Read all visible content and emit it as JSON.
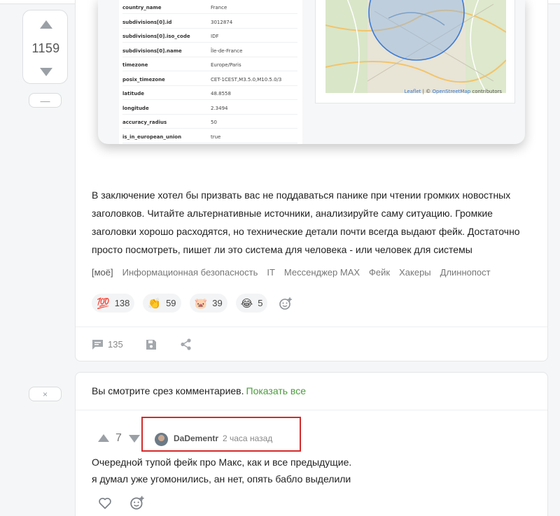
{
  "post": {
    "rating": "1159",
    "collapse_label": "—",
    "screenshot": {
      "rows": [
        {
          "key": "country_name",
          "value": "France"
        },
        {
          "key": "subdivisions[0].id",
          "value": "3012874"
        },
        {
          "key": "subdivisions[0].iso_code",
          "value": "IDF"
        },
        {
          "key": "subdivisions[0].name",
          "value": "Île-de-France"
        },
        {
          "key": "timezone",
          "value": "Europe/Paris"
        },
        {
          "key": "posix_timezone",
          "value": "CET-1CEST,M3.5.0,M10.5.0/3"
        },
        {
          "key": "latitude",
          "value": "48.8558"
        },
        {
          "key": "longitude",
          "value": "2.3494"
        },
        {
          "key": "accuracy_radius",
          "value": "50"
        },
        {
          "key": "is_in_european_union",
          "value": "true"
        }
      ],
      "map_attribution": {
        "leaflet": "Leaflet",
        "sep": " | © ",
        "osm": "OpenStreetMap",
        "suffix": " contributors"
      }
    },
    "text_lines": [
      "В заключение хотел бы призвать вас не поддаваться панике при чтении громких новостных",
      "заголовков. Читайте альтернативные источники, анализируйте саму ситуацию. Громкие",
      "заголовки хорошо расходятся, но технические детали почти всегда выдают фейк. Достаточно",
      "просто посмотреть, пишет ли это система для человека - или человек для системы"
    ],
    "tags": [
      "[моё]",
      "Информационная безопасность",
      "IT",
      "Мессенджер MAX",
      "Фейк",
      "Хакеры",
      "Длиннопост"
    ],
    "reactions": [
      {
        "emoji": "💯",
        "count": "138"
      },
      {
        "emoji": "👏",
        "count": "59"
      },
      {
        "emoji": "🐷",
        "count": "39"
      },
      {
        "emoji": "😂",
        "count": "5"
      }
    ],
    "comments_count": "135"
  },
  "comments": {
    "close_label": "×",
    "slice_note": "Вы смотрите срез комментариев.",
    "show_all": "Показать все",
    "item": {
      "rating": "7",
      "author": "DaDementr",
      "time": "2 часа назад",
      "lines": [
        "Очередной тупой фейк про Макс, как и все предыдущие.",
        "я думал уже угомонились, ан нет, опять бабло выделили"
      ]
    }
  },
  "colors": {
    "accent_green": "#4a9c3b",
    "highlight_red": "#d32b2b",
    "map_circle": "#3b7bd6"
  }
}
